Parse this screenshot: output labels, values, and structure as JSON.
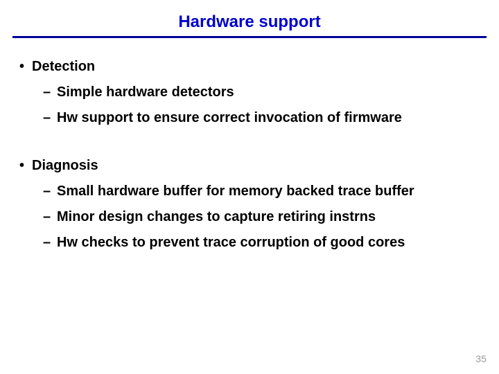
{
  "title": "Hardware support",
  "sections": [
    {
      "heading": "Detection",
      "items": [
        "Simple hardware detectors",
        "Hw support to ensure correct invocation of firmware"
      ]
    },
    {
      "heading": "Diagnosis",
      "items": [
        "Small hardware buffer for memory backed trace buffer",
        "Minor design changes to capture retiring instrns",
        "Hw checks to prevent trace corruption of good cores"
      ]
    }
  ],
  "page_number": "35"
}
